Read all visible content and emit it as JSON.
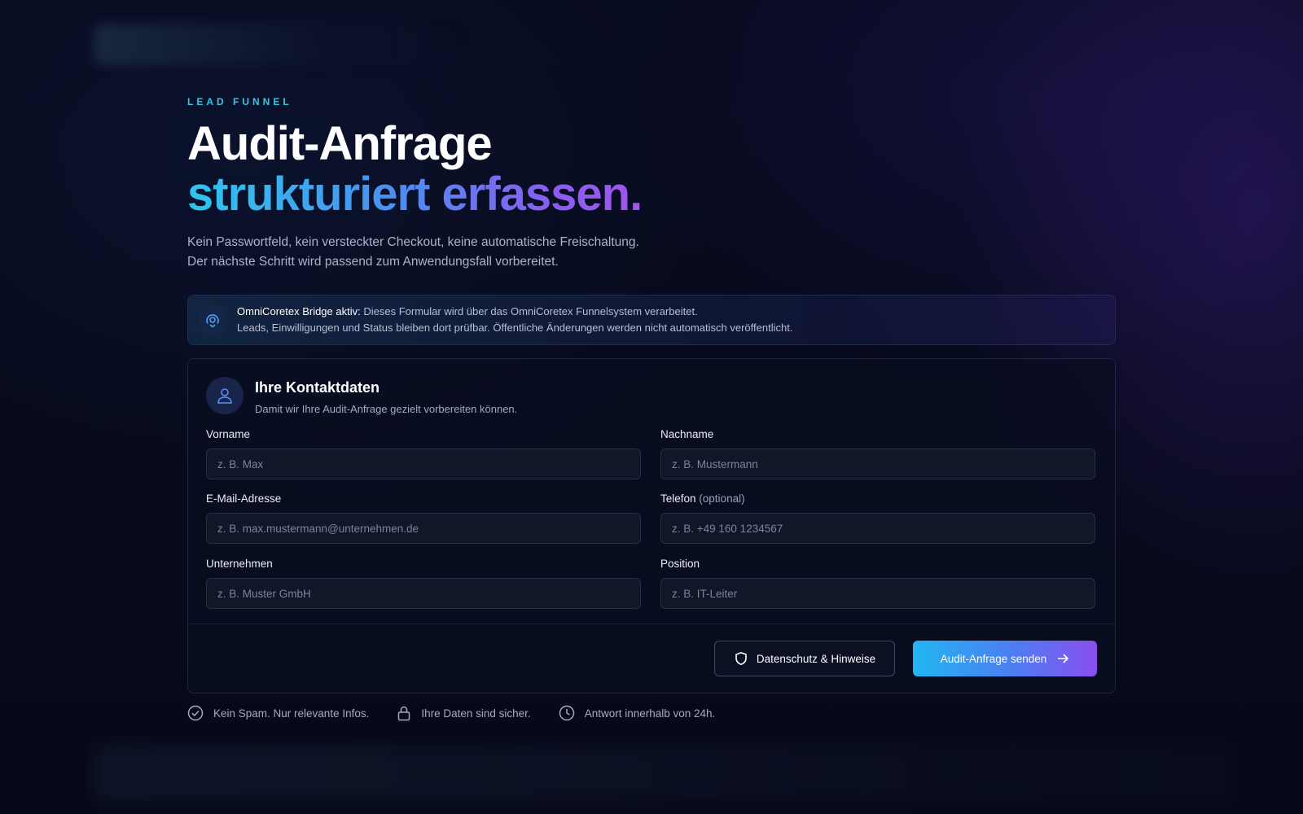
{
  "header": {
    "eyebrow": "LEAD FUNNEL",
    "title_line1": "Audit-Anfrage",
    "title_line2": "strukturiert erfassen.",
    "lead_line1": "Kein Passwortfeld, kein versteckter Checkout, keine automatische Freischaltung.",
    "lead_line2": "Der nächste Schritt wird passend zum Anwendungsfall vorbereitet."
  },
  "bridge": {
    "icon": "bridge-signal-icon",
    "label": "OmniCoretex Bridge aktiv:",
    "text_line1": " Dieses Formular wird über das OmniCoretex Funnelsystem verarbeitet.",
    "text_line2": "Leads, Einwilligungen und Status bleiben dort prüfbar. Öffentliche Änderungen werden nicht automatisch veröffentlicht."
  },
  "form": {
    "title": "Ihre Kontaktdaten",
    "subtitle": "Damit wir Ihre Audit-Anfrage gezielt vorbereiten können.",
    "fields": {
      "first_name": {
        "label": "Vorname",
        "placeholder": "z. B. Max"
      },
      "last_name": {
        "label": "Nachname",
        "placeholder": "z. B. Mustermann"
      },
      "email": {
        "label": "E-Mail-Adresse",
        "placeholder": "z. B. max.mustermann@unternehmen.de"
      },
      "phone": {
        "label": "Telefon",
        "label_optional": " (optional)",
        "placeholder": "z. B. +49 160 1234567"
      },
      "company": {
        "label": "Unternehmen",
        "placeholder": "z. B. Muster GmbH"
      },
      "position": {
        "label": "Position",
        "placeholder": "z. B. IT-Leiter"
      }
    },
    "privacy_button": "Datenschutz & Hinweise",
    "submit_button": "Audit-Anfrage senden"
  },
  "trust": [
    {
      "icon": "check-circle-icon",
      "text": "Kein Spam. Nur relevante Infos."
    },
    {
      "icon": "lock-icon",
      "text": "Ihre Daten sind sicher."
    },
    {
      "icon": "clock-icon",
      "text": "Antwort innerhalb von 24h."
    }
  ],
  "colors": {
    "accent_cyan": "#35c6e8",
    "accent_purple": "#8a4ff0",
    "background": "#070a1c"
  }
}
